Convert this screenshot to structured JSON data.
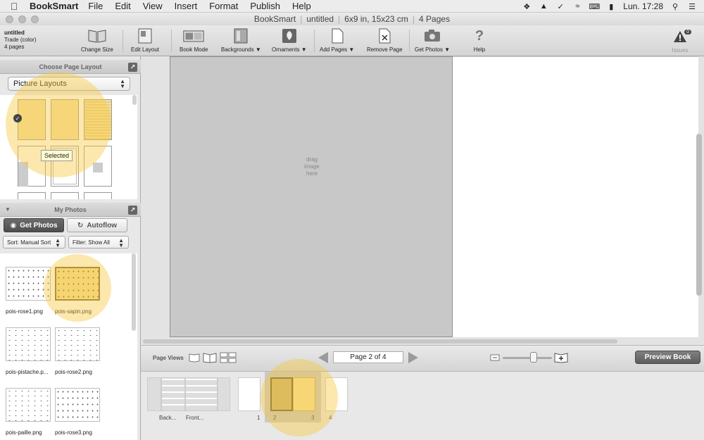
{
  "menubar": {
    "app_name": "BookSmart",
    "items": [
      "File",
      "Edit",
      "View",
      "Insert",
      "Format",
      "Publish",
      "Help"
    ],
    "clock": "Lun. 17:28",
    "status_icons": [
      "dropbox-icon",
      "adobe-icon",
      "checkmark-icon",
      "wifi-icon",
      "keyboard-icon",
      "battery-icon",
      "search-icon",
      "list-icon"
    ]
  },
  "window": {
    "title_parts": [
      "BookSmart",
      "untitled",
      "6x9 in, 15x23 cm",
      "4 Pages"
    ]
  },
  "book_info": {
    "name": "untitled",
    "format": "Trade (color)",
    "pages": "4 pages"
  },
  "toolbar": {
    "change_size": "Change Size",
    "edit_layout": "Edit Layout",
    "book_mode": "Book Mode",
    "backgrounds": "Backgrounds ▼",
    "ornaments": "Ornaments ▼",
    "add_pages": "Add Pages ▼",
    "remove_page": "Remove Page",
    "get_photos": "Get Photos ▼",
    "help": "Help",
    "issues": "Issues",
    "issues_count": "0"
  },
  "layout_panel": {
    "title": "Choose Page Layout",
    "select_value": "Picture Layouts",
    "tooltip": "Selected"
  },
  "photos_panel": {
    "title": "My Photos",
    "get_photos": "Get Photos",
    "autoflow": "Autoflow",
    "sort": "Sort:  Manual Sort",
    "filter": "Filter:  Show All",
    "photos": [
      {
        "name": "pois-rose1.png"
      },
      {
        "name": "pois-sapin.png"
      },
      {
        "name": "pois-pistache.p..."
      },
      {
        "name": "pois-rose2.png"
      },
      {
        "name": "pois-paille.png"
      },
      {
        "name": "pois-rose3.png"
      }
    ]
  },
  "canvas": {
    "drag_text": "drag image here"
  },
  "page_views": {
    "label": "Page Views",
    "page_indicator": "Page 2 of 4",
    "preview_button": "Preview Book"
  },
  "filmstrip": {
    "labels": [
      "Back...",
      "Front...",
      "1",
      "2",
      "3",
      "4"
    ]
  },
  "colors": {
    "highlight": "#f7c83c",
    "selected_page": "#c9b376",
    "gold_page": "#f7e0a0"
  }
}
